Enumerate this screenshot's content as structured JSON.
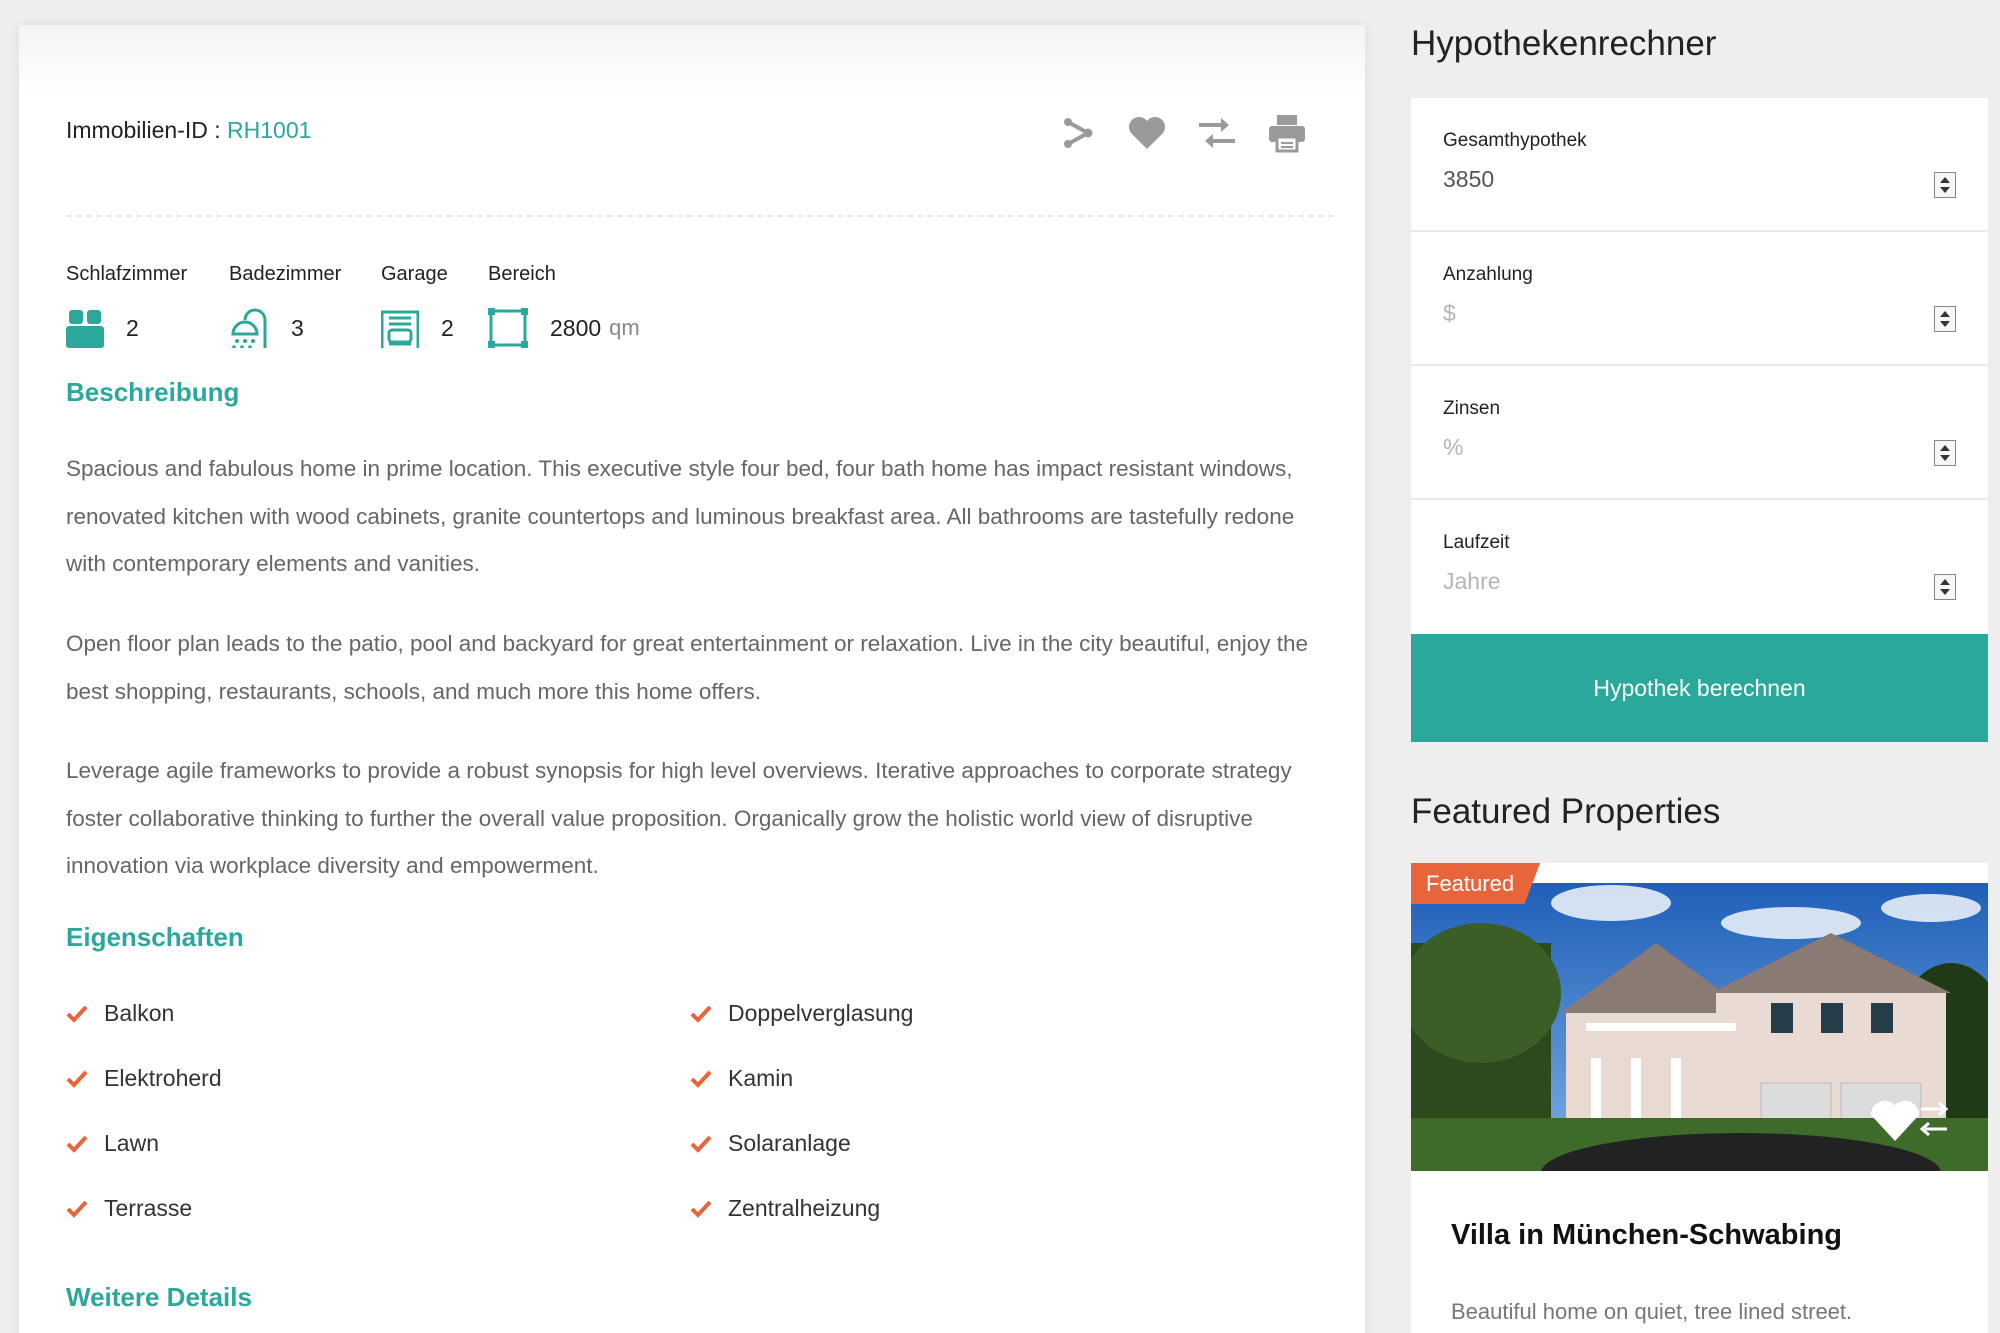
{
  "property": {
    "id_label": "Immobilien-ID :",
    "id_value": "RH1001"
  },
  "actions": [
    "share-icon",
    "heart-icon",
    "compare-icon",
    "print-icon"
  ],
  "facts": [
    {
      "label": "Schlafzimmer",
      "value": "2",
      "icon": "bed-icon"
    },
    {
      "label": "Badezimmer",
      "value": "3",
      "icon": "shower-icon"
    },
    {
      "label": "Garage",
      "value": "2",
      "icon": "garage-icon"
    },
    {
      "label": "Bereich",
      "value": "2800",
      "unit": "qm",
      "icon": "area-icon"
    }
  ],
  "description": {
    "title": "Beschreibung",
    "paragraphs": [
      "Spacious and fabulous home in prime location. This executive style four bed, four bath home has impact resistant windows, renovated kitchen with wood cabinets, granite countertops and luminous breakfast area. All bathrooms are tastefully redone with contemporary elements and vanities.",
      "Open floor plan leads to the patio, pool and backyard for great entertainment or relaxation. Live in the city beautiful, enjoy the best shopping, restaurants, schools, and much more this home offers.",
      "Leverage agile frameworks to provide a robust synopsis for high level overviews. Iterative approaches to corporate strategy foster collaborative thinking to further the overall value proposition. Organically grow the holistic world view of disruptive innovation via workplace diversity and empowerment."
    ]
  },
  "features": {
    "title": "Eigenschaften",
    "items": [
      "Balkon",
      "Doppelverglasung",
      "Elektroherd",
      "Kamin",
      "Lawn",
      "Solaranlage",
      "Terrasse",
      "Zentralheizung"
    ]
  },
  "more_details": {
    "title": "Weitere Details"
  },
  "calculator": {
    "title": "Hypothekenrechner",
    "fields": [
      {
        "label": "Gesamthypothek",
        "value": "3850",
        "placeholder": ""
      },
      {
        "label": "Anzahlung",
        "value": "",
        "placeholder": "$"
      },
      {
        "label": "Zinsen",
        "value": "",
        "placeholder": "%"
      },
      {
        "label": "Laufzeit",
        "value": "",
        "placeholder": "Jahre"
      }
    ],
    "button": "Hypothek berechnen"
  },
  "featured": {
    "title": "Featured Properties",
    "badge": "Featured",
    "card_title": "Villa in München-Schwabing",
    "card_desc": "Beautiful home on quiet, tree lined street."
  },
  "colors": {
    "accent": "#2aa89b",
    "badge": "#e8643b",
    "check": "#e8643b"
  }
}
